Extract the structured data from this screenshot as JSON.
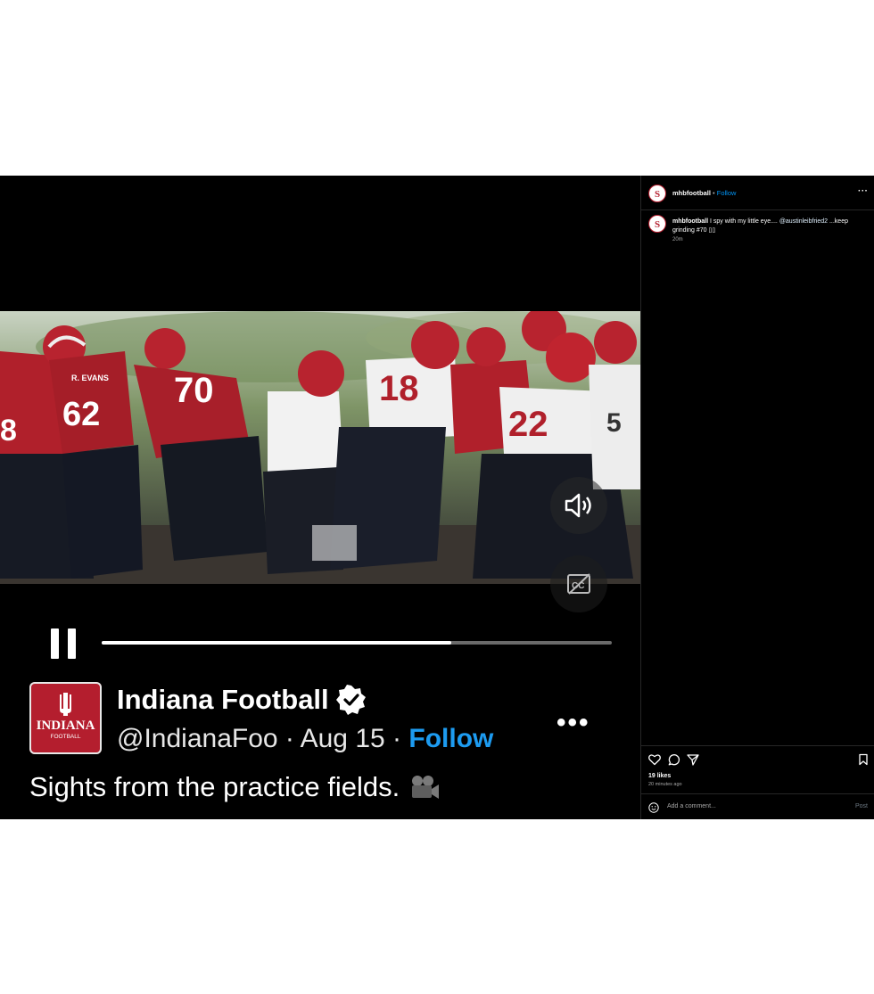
{
  "twitter": {
    "logo_text": "INDIANA",
    "logo_sub": "FOOTBALL",
    "name": "Indiana Football",
    "handle": "@IndianaFoo",
    "sep1": "·",
    "date": "Aug 15",
    "sep2": "·",
    "follow": "Follow",
    "more": "•••",
    "text": "Sights from the practice fields.",
    "text_icon": "movie-camera-icon"
  },
  "video": {
    "progress": 0.685,
    "jersey_numbers": [
      "8",
      "62",
      "70",
      "18",
      "22",
      "5"
    ],
    "name_bar": "R. EVANS",
    "controls": [
      "pause-icon",
      "volume-icon",
      "closed-captions-icon"
    ]
  },
  "instagram": {
    "username": "mhbfootball",
    "dot": "•",
    "follow": "Follow",
    "more": "···",
    "caption_user": "mhbfootball",
    "caption_text": " I spy with my little eye.... ",
    "caption_mention": "@austinleibfried2",
    "caption_rest": " ...keep grinding #70 ▯▯",
    "caption_time": "20m",
    "likes": "19 likes",
    "posted_ago": "20 minutes ago",
    "comment_placeholder": "Add a comment...",
    "post_button": "Post"
  },
  "colors": {
    "indiana_crimson": "#b41e2e",
    "follow_blue": "#1d9bf0",
    "instagram_blue": "#0095f6"
  }
}
